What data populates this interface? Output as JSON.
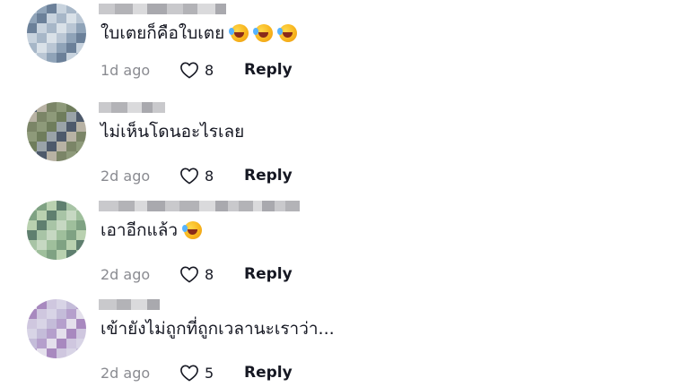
{
  "comments": [
    {
      "text": "ใบเตยก็คือใบเตย",
      "emoji_count": 3,
      "emoji": "rolling-on-floor-laughing-emoji",
      "time": "1d ago",
      "likes": "8",
      "reply_label": "Reply",
      "avatar_colors": [
        "#b9c6d4",
        "#8fa3b8",
        "#6b8099",
        "#c8d3de",
        "#a7b7c8",
        "#d9e1e8"
      ]
    },
    {
      "text": "ไม่เห็นโดนอะไรเลย",
      "emoji_count": 0,
      "emoji": "",
      "time": "2d ago",
      "likes": "8",
      "reply_label": "Reply",
      "avatar_colors": [
        "#8e9a7a",
        "#6f7d5c",
        "#9aa3a8",
        "#4e5a6b",
        "#b8b2a4",
        "#7b8567"
      ]
    },
    {
      "text": "เอาอีกแล้ว",
      "emoji_count": 1,
      "emoji": "rolling-on-floor-laughing-emoji",
      "time": "2d ago",
      "likes": "8",
      "reply_label": "Reply",
      "avatar_colors": [
        "#9fbf9c",
        "#7fa283",
        "#b9d1b0",
        "#5f7f6f",
        "#a8c4a6",
        "#c6d8c2"
      ]
    },
    {
      "text": "เข้ายังไม่ถูกที่ถูกเวลานะเราว่า...",
      "emoji_count": 0,
      "emoji": "",
      "time": "2d ago",
      "likes": "5",
      "reply_label": "Reply",
      "avatar_colors": [
        "#d8d4e6",
        "#c4bcd9",
        "#b59fcc",
        "#e4e0ec",
        "#a889bf",
        "#cfc7df"
      ]
    }
  ],
  "colors": {
    "text": "#161823",
    "muted": "#8a8b91",
    "background": "#ffffff"
  },
  "icons": {
    "like": "heart-outline-icon"
  }
}
